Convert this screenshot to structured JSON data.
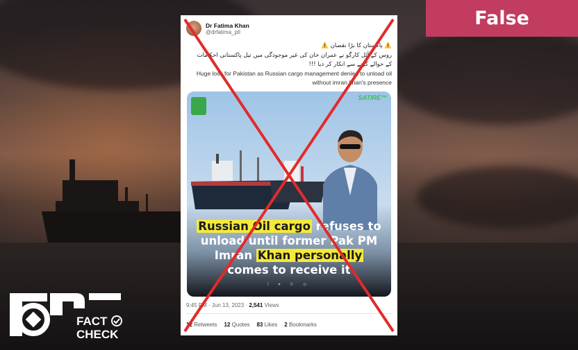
{
  "verdict": "False",
  "tweet": {
    "author_name": "Dr Fatima Khan",
    "author_handle": "@drfatima_ptl",
    "urdu_line1": "⚠️ پاکستان کا بڑا نقصان ⚠️",
    "urdu_line2": "روس کے آئل کارگو نے عمران خان کی غیر موجودگی میں تیل پاکستانی احکامات کے حوالے کرنے سے انکار کر دیا !!!",
    "english_text": "Huge loss for Pakistan as Russian cargo management denied to unload oil without imran khan's presence",
    "image": {
      "satire_label": "SATIRE™",
      "caption_hl1": "Russian Oil cargo",
      "caption_rest1": " refuses to",
      "caption_line2": "unload until former Pak PM",
      "caption_line3a": "Imran ",
      "caption_hl2": "Khan personally",
      "caption_line4": "comes to receive it",
      "share_icons": "f ♥ ✆ ◎"
    },
    "time": "9:45 PM",
    "date": "· Jun 13, 2023 ·",
    "views_count": "2,541",
    "views_label": "Views",
    "retweets_count": "12",
    "retweets_label": "Retweets",
    "quotes_count": "12",
    "quotes_label": "Quotes",
    "likes_count": "83",
    "likes_label": "Likes",
    "bookmarks_count": "2",
    "bookmarks_label": "Bookmarks"
  },
  "brand": {
    "logo_text_1": "FACT",
    "logo_text_2": "CHECK"
  },
  "colors": {
    "badge": "#c23c5f",
    "cross": "#e02b2b",
    "highlight": "#f5e93a"
  }
}
